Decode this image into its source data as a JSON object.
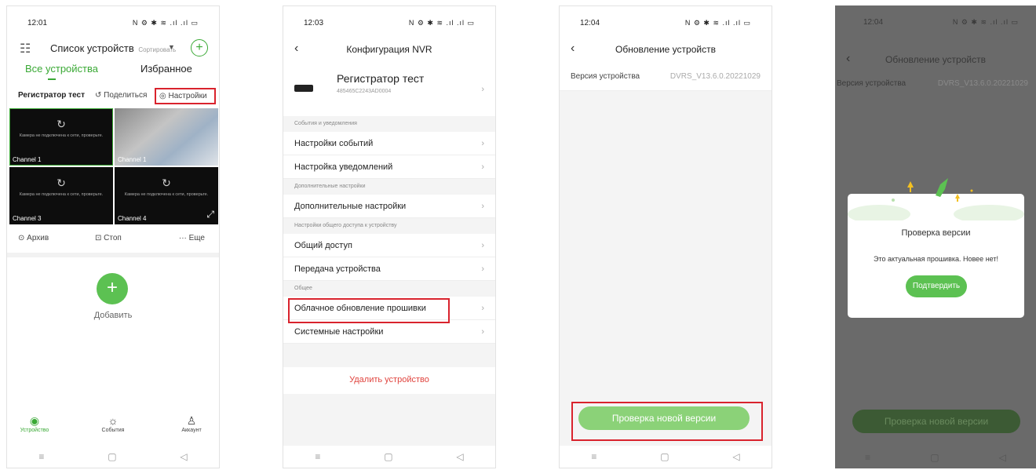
{
  "phone1": {
    "time": "12:01",
    "indicators": "N ⚙ ✱ ≋ .ıl .ıl ▭",
    "header": {
      "title": "Список устройств",
      "sort": "Сортировать"
    },
    "tabs": {
      "all": "Все устройства",
      "favorites": "Избранное"
    },
    "subbar": {
      "device": "Регистратор тест",
      "share": "Поделиться",
      "settings": "Настройки"
    },
    "channels": [
      {
        "label": "Channel 1",
        "message": "Камера не подключена к сети, проверьте."
      },
      {
        "label": "Channel 1"
      },
      {
        "label": "Channel 3",
        "message": "Камера не подключена к сети, проверьте."
      },
      {
        "label": "Channel 4",
        "message": "Камера не подключена к сети, проверьте."
      }
    ],
    "actions": {
      "archive": "Архив",
      "stop": "Стоп",
      "more": "Еще"
    },
    "add_label": "Добавить",
    "bottom_tabs": {
      "device": "Устройство",
      "events": "События",
      "account": "Аккаунт"
    }
  },
  "phone2": {
    "time": "12:03",
    "indicators": "N ⚙ ✱ ≋ .ıl .ıl ▭",
    "title": "Конфигурация NVR",
    "device": {
      "name": "Регистратор тест",
      "serial": "485465C2243AD0004"
    },
    "sections": {
      "events": "События и уведомления",
      "extra": "Дополнительные настройки",
      "sharing": "Настройки общего доступа к устройству",
      "general": "Общее"
    },
    "rows": {
      "event_settings": "Настройки событий",
      "notify_settings": "Настройка уведомлений",
      "extra_settings": "Дополнительные настройки",
      "share": "Общий доступ",
      "transfer": "Передача устройства",
      "cloud_update": "Облачное обновление прошивки",
      "system": "Системные настройки"
    },
    "delete": "Удалить устройство"
  },
  "phone3": {
    "time": "12:04",
    "indicators": "N ⚙ ✱ ≋ .ıl .ıl ▭",
    "title": "Обновление устройств",
    "version_label": "Версия устройства",
    "version_value": "DVRS_V13.6.0.20221029",
    "check_button": "Проверка новой версии"
  },
  "phone4": {
    "time": "12:04",
    "indicators": "N ⚙ ✱ ≋ .ıl .ıl ▭",
    "title": "Обновление устройств",
    "version_label": "Версия устройства",
    "version_value": "DVRS_V13.6.0.20221029",
    "check_button": "Проверка новой версии",
    "dialog": {
      "title": "Проверка версии",
      "message": "Это актуальная прошивка. Новее нет!",
      "confirm": "Подтвердить"
    }
  },
  "colors": {
    "accent": "#3aa935",
    "highlight": "#d9232d",
    "danger": "#e0443e"
  }
}
